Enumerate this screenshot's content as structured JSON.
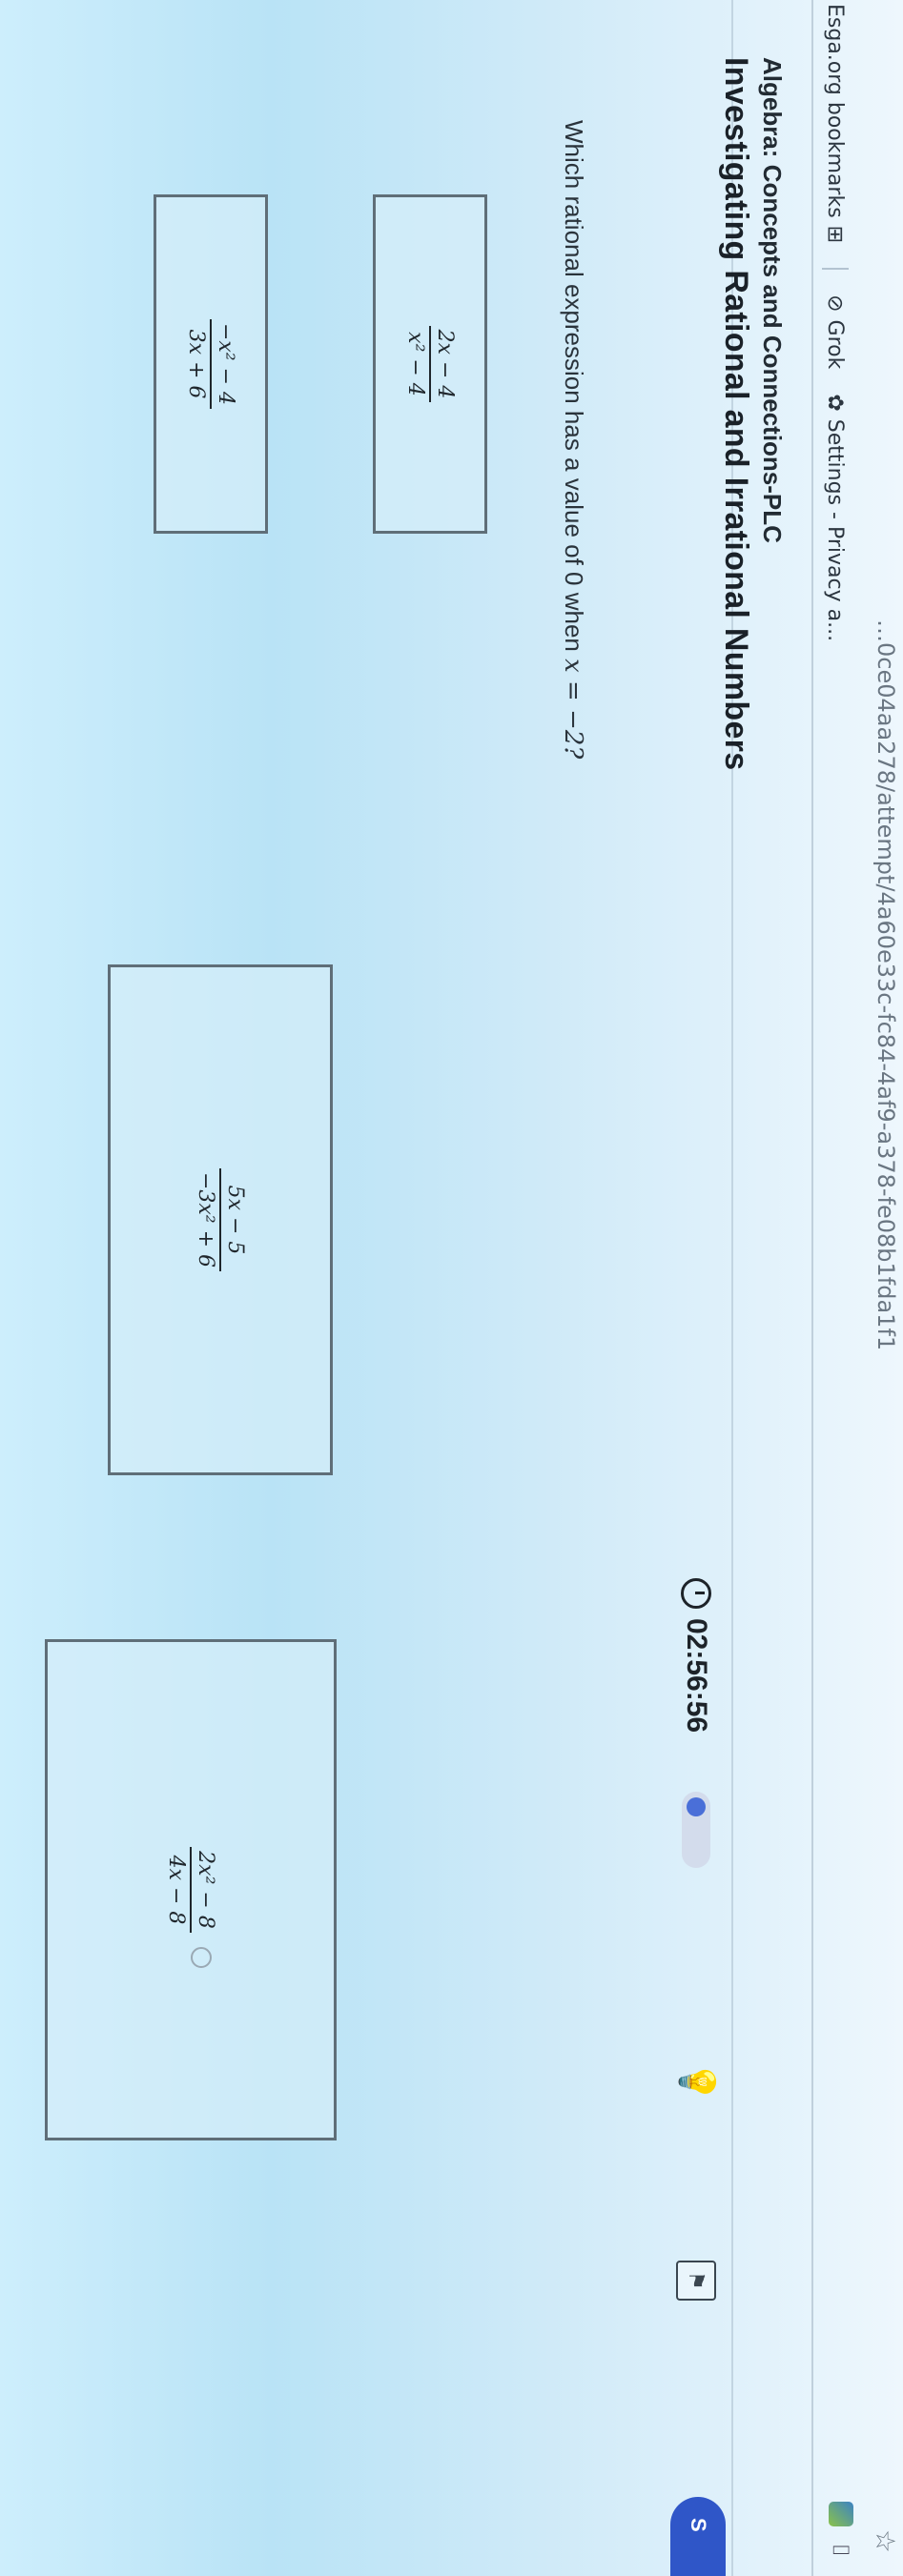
{
  "browser": {
    "url_fragment": "…0ce04aa278/attempt/4a60e33c-fc84-4af9-a378-fe08b1fda1f1",
    "bookmarks": [
      {
        "label": "Esga.org bookmarks",
        "icon": "grid-icon"
      },
      {
        "label": "Grok",
        "icon": "grok-icon"
      },
      {
        "label": "Settings - Privacy a...",
        "icon": "gear-icon"
      }
    ]
  },
  "header": {
    "course": "Algebra: Concepts and Connections-PLC",
    "lesson": "Investigating Rational and Irrational Numbers",
    "timer": "02:56:56",
    "right_button": "S"
  },
  "question": {
    "prompt": "Which rational expression has a value of 0 when",
    "condition": "x = −2?"
  },
  "choices": [
    {
      "numerator": "2x − 4",
      "denominator": "x² − 4"
    },
    {
      "numerator": "−x² − 4",
      "denominator": "3x + 6"
    },
    {
      "numerator": "5x − 5",
      "denominator": "−3x² + 6"
    },
    {
      "numerator": "2x² − 8",
      "denominator": "4x − 8"
    }
  ]
}
